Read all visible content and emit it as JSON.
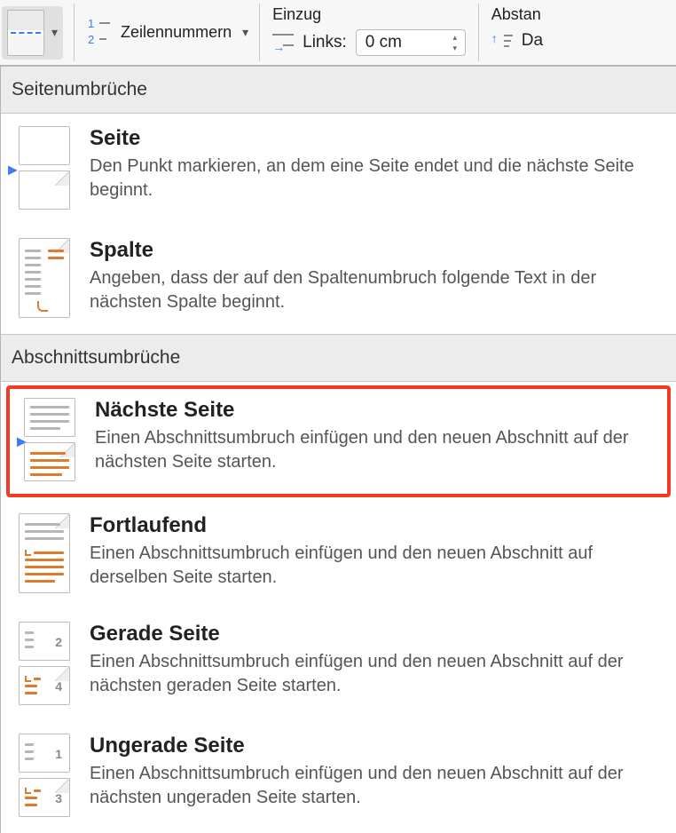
{
  "ribbon": {
    "line_numbers_label": "Zeilennummern",
    "indent": {
      "title": "Einzug",
      "left_label": "Links:",
      "left_value": "0 cm"
    },
    "spacing": {
      "title": "Abstan",
      "after_label": "Da"
    }
  },
  "sections": {
    "page_breaks_header": "Seitenumbrüche",
    "section_breaks_header": "Abschnittsumbrüche"
  },
  "items": {
    "page": {
      "title": "Seite",
      "desc": "Den Punkt markieren, an dem eine Seite endet und die nächste Seite beginnt."
    },
    "column": {
      "title": "Spalte",
      "desc": "Angeben, dass der auf den Spaltenumbruch folgende Text in der nächsten Spalte beginnt."
    },
    "next_page": {
      "title": "Nächste Seite",
      "desc": "Einen Abschnittsumbruch einfügen und den neuen Abschnitt auf der nächsten Seite starten."
    },
    "continuous": {
      "title": "Fortlaufend",
      "desc": "Einen Abschnittsumbruch einfügen und den neuen Abschnitt auf derselben Seite starten."
    },
    "even": {
      "title": "Gerade Seite",
      "desc": "Einen Abschnittsumbruch einfügen und den neuen Abschnitt auf der nächsten geraden Seite starten.",
      "num_top": "2",
      "num_bot": "4"
    },
    "odd": {
      "title": "Ungerade Seite",
      "desc": "Einen Abschnittsumbruch einfügen und den neuen Abschnitt auf der nächsten ungeraden Seite starten.",
      "num_top": "1",
      "num_bot": "3"
    }
  }
}
